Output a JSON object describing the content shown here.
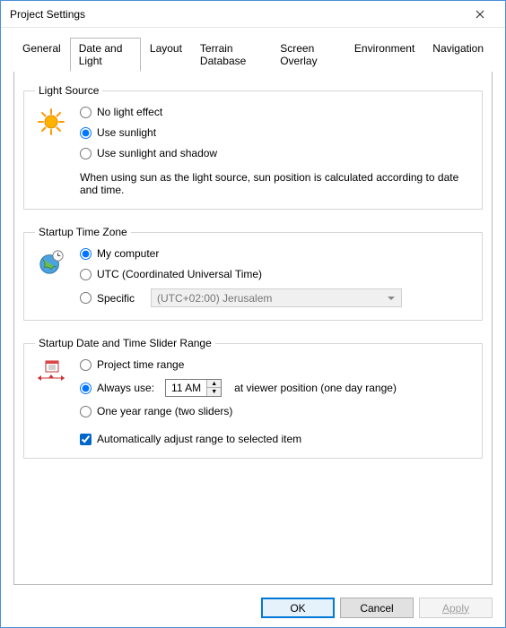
{
  "window": {
    "title": "Project Settings"
  },
  "tabs": {
    "general": "General",
    "date_light": "Date and Light",
    "layout": "Layout",
    "terrain_db": "Terrain Database",
    "screen_overlay": "Screen Overlay",
    "environment": "Environment",
    "navigation": "Navigation"
  },
  "light_source": {
    "legend": "Light Source",
    "no_effect": "No light effect",
    "use_sunlight": "Use sunlight",
    "use_sun_shadow": "Use sunlight and shadow",
    "info": "When using sun as the light source, sun position is calculated according to date and time."
  },
  "startup_tz": {
    "legend": "Startup Time Zone",
    "my_computer": "My computer",
    "utc": "UTC (Coordinated Universal Time)",
    "specific": "Specific",
    "combo_value": "(UTC+02:00) Jerusalem"
  },
  "startup_range": {
    "legend": "Startup Date and Time Slider Range",
    "project_range": "Project time range",
    "always_use": "Always use:",
    "time_value": "11 AM",
    "time_suffix": "at viewer position (one day range)",
    "one_year": "One year range (two sliders)",
    "auto_adjust": "Automatically adjust range to selected item"
  },
  "buttons": {
    "ok": "OK",
    "cancel": "Cancel",
    "apply": "Apply"
  }
}
